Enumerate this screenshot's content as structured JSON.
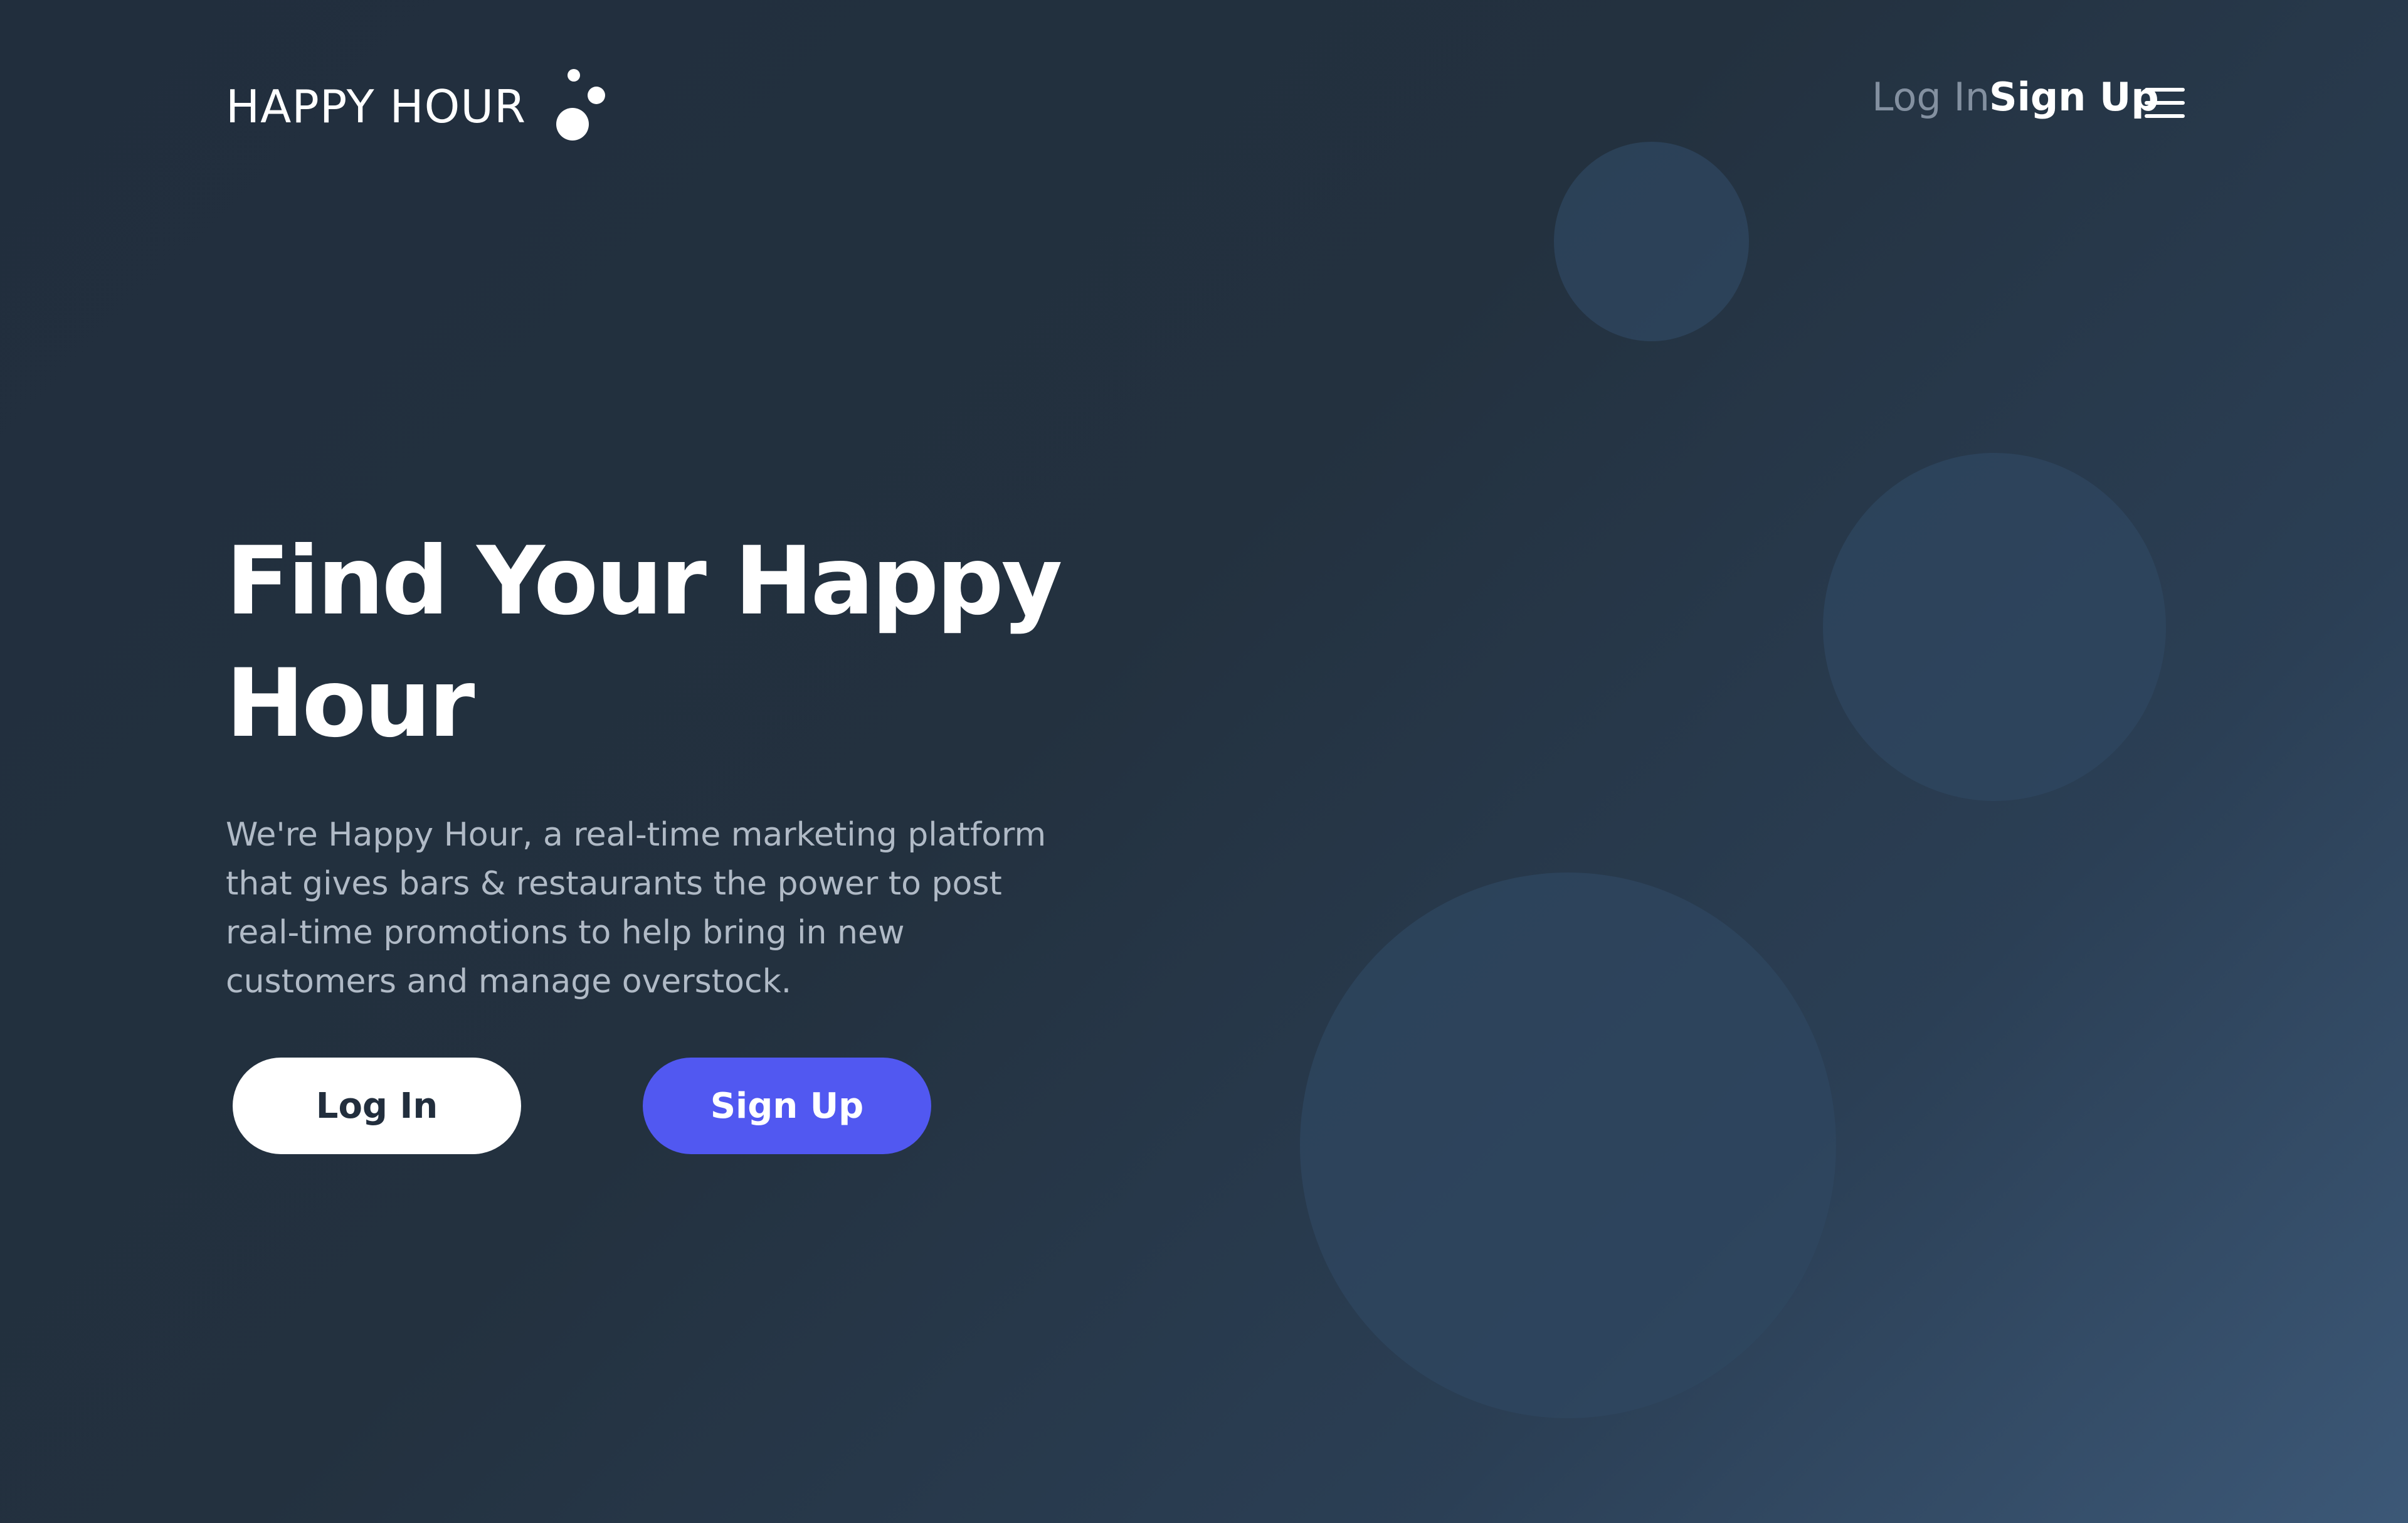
{
  "brand": {
    "name": "HAPPY HOUR",
    "logo_icon": "bubbles-icon"
  },
  "nav": {
    "login_label": "Log In",
    "signup_label": "Sign Up",
    "menu_icon": "hamburger-menu-icon"
  },
  "hero": {
    "title": "Find Your Happy Hour",
    "description": "We're Happy Hour, a real-time marketing platform that gives bars & restaurants the power to post real-time promotions to help bring in new customers and manage overstock."
  },
  "actions": {
    "login_label": "Log In",
    "signup_label": "Sign Up"
  },
  "colors": {
    "background_dark": "#212e3d",
    "background_light": "#3c5877",
    "bubble": "#2f4760",
    "accent": "#5158f1",
    "text_primary": "#ffffff",
    "text_muted": "#8390a0",
    "text_body": "#b0bac6"
  }
}
